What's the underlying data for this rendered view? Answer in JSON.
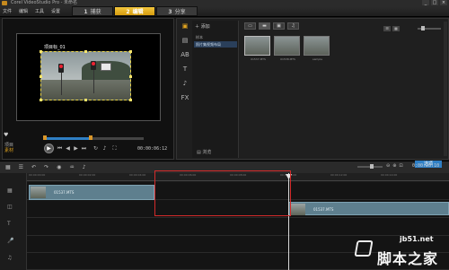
{
  "window": {
    "title": "Corel VideoStudio Pro - 未命名",
    "controls": [
      "_",
      "□",
      "×"
    ]
  },
  "menu": [
    "文件",
    "编辑",
    "工具",
    "设置"
  ],
  "steps": [
    {
      "num": "1",
      "label": "捕获"
    },
    {
      "num": "2",
      "label": "编辑"
    },
    {
      "num": "3",
      "label": "分享"
    }
  ],
  "preview": {
    "clip_title": "项目标_01",
    "modes": {
      "project": "项目",
      "clip": "素材"
    },
    "timecode": "00:00:06:12",
    "icons": {
      "play": "play-icon",
      "prev": "home-icon",
      "rewind": "step-back-icon",
      "forward": "step-forward-icon",
      "end": "end-icon",
      "repeat": "repeat-icon",
      "volume": "volume-icon",
      "fullscreen": "fullscreen-icon"
    }
  },
  "library": {
    "add_label": "添加",
    "folders": [
      "样本",
      "照片集视频布局"
    ],
    "browse_label": "浏览",
    "thumbnails": [
      "01537.MTS",
      "01538.MTS",
      "sample"
    ],
    "side_icons": [
      "▣",
      "▤",
      "AB",
      "T",
      "♪",
      "FX"
    ]
  },
  "options_label": "选项",
  "timeline": {
    "timecode": "0:00:28:10",
    "ticks": [
      "00:00:00:00",
      "00:00:02:00",
      "00:00:04:00",
      "00:00:06:00",
      "00:00:08:00",
      "00:00:10:00",
      "00:00:12:00",
      "00:00:14:00",
      "00:00:16:00"
    ],
    "clips": [
      {
        "label": "01537.MTS"
      },
      {
        "label": "01537.MTS"
      }
    ]
  },
  "watermark": {
    "site": "jb51.net",
    "name": "脚本之家"
  }
}
